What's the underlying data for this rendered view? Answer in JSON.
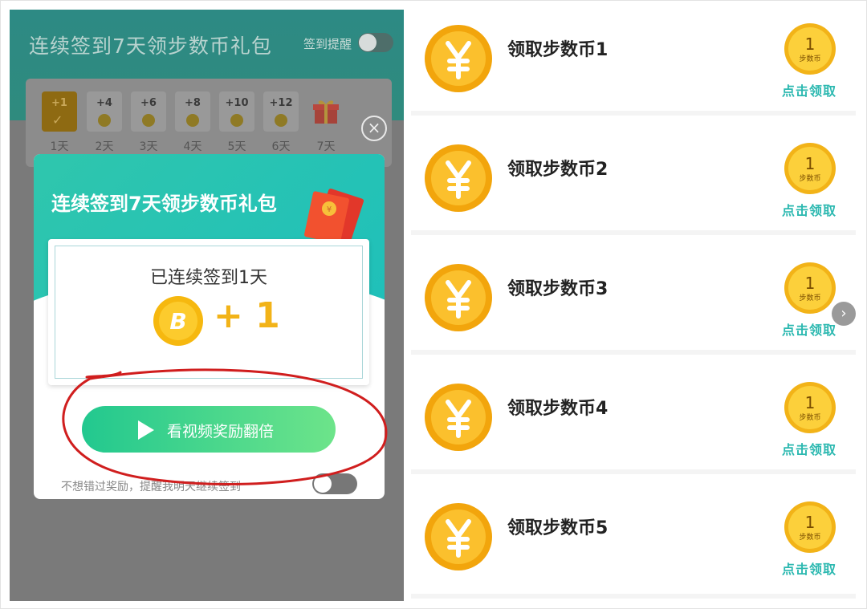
{
  "header": {
    "title": "连续签到7天领步数币礼包",
    "remind_label": "签到提醒"
  },
  "days": [
    {
      "points": "+1",
      "label": "1天"
    },
    {
      "points": "+4",
      "label": "2天"
    },
    {
      "points": "+6",
      "label": "3天"
    },
    {
      "points": "+8",
      "label": "4天"
    },
    {
      "points": "+10",
      "label": "5天"
    },
    {
      "points": "+12",
      "label": "6天"
    },
    {
      "points": "",
      "label": "7天"
    }
  ],
  "modal": {
    "title": "连续签到7天领步数币礼包",
    "streak_text": "已连续签到1天",
    "reward": "+ 1",
    "coin_letter": "B",
    "video_button": "看视频奖励翻倍",
    "remind_text": "不想错过奖励，提醒我明天继续签到"
  },
  "list": [
    {
      "name": "领取步数币1",
      "badge_num": "1",
      "badge_unit": "步数币",
      "claim": "点击领取"
    },
    {
      "name": "领取步数币2",
      "badge_num": "1",
      "badge_unit": "步数币",
      "claim": "点击领取"
    },
    {
      "name": "领取步数币3",
      "badge_num": "1",
      "badge_unit": "步数币",
      "claim": "点击领取"
    },
    {
      "name": "领取步数币4",
      "badge_num": "1",
      "badge_unit": "步数币",
      "claim": "点击领取"
    },
    {
      "name": "领取步数币5",
      "badge_num": "1",
      "badge_unit": "步数币",
      "claim": "点击领取"
    }
  ],
  "colors": {
    "accent": "#2bb8b0",
    "coin": "#f2b318",
    "annotation": "#d01e1e"
  }
}
